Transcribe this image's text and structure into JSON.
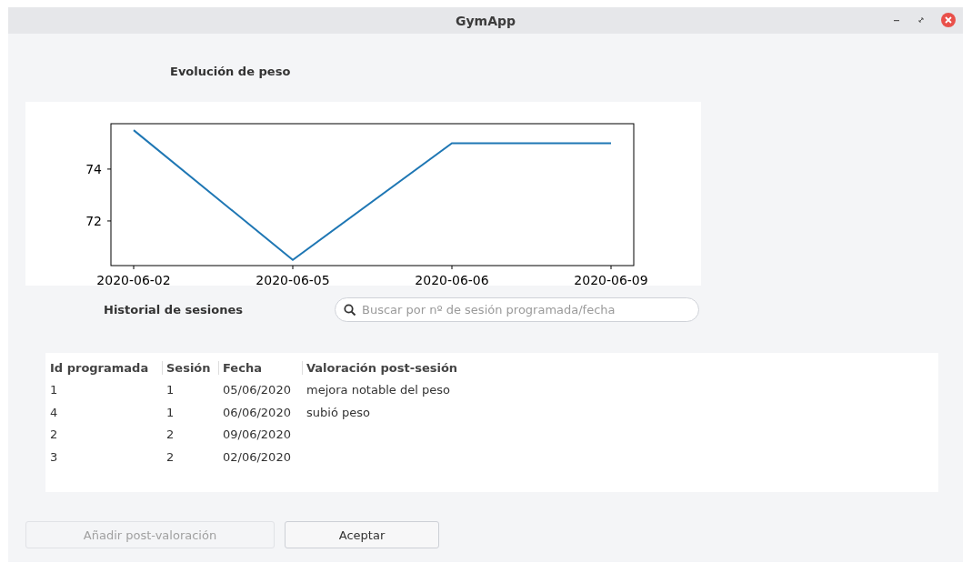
{
  "window": {
    "title": "GymApp"
  },
  "chart_title": "Evolución de peso",
  "chart": {
    "chart_data": {
      "type": "line",
      "categories": [
        "2020-06-02",
        "2020-06-05",
        "2020-06-06",
        "2020-06-09"
      ],
      "series": [
        {
          "color": "#1f77b4",
          "values": [
            75.5,
            70.5,
            75.0,
            75.0
          ]
        }
      ],
      "ylim": [
        70.28,
        75.75
      ],
      "yticks": [
        72,
        74
      ]
    }
  },
  "history_title": "Historial de sesiones",
  "search": {
    "placeholder": "Buscar por nº de sesión programada/fecha"
  },
  "table": {
    "columns": [
      "Id programada",
      "Sesión",
      "Fecha",
      "Valoración post-sesión"
    ],
    "rows": [
      [
        "1",
        "1",
        "05/06/2020",
        "mejora notable del peso"
      ],
      [
        "4",
        "1",
        "06/06/2020",
        "subió peso"
      ],
      [
        "2",
        "2",
        "09/06/2020",
        ""
      ],
      [
        "3",
        "2",
        "02/06/2020",
        ""
      ]
    ]
  },
  "buttons": [
    {
      "label": "Añadir post-valoración",
      "disabled": true
    },
    {
      "label": "Aceptar",
      "disabled": false
    }
  ]
}
